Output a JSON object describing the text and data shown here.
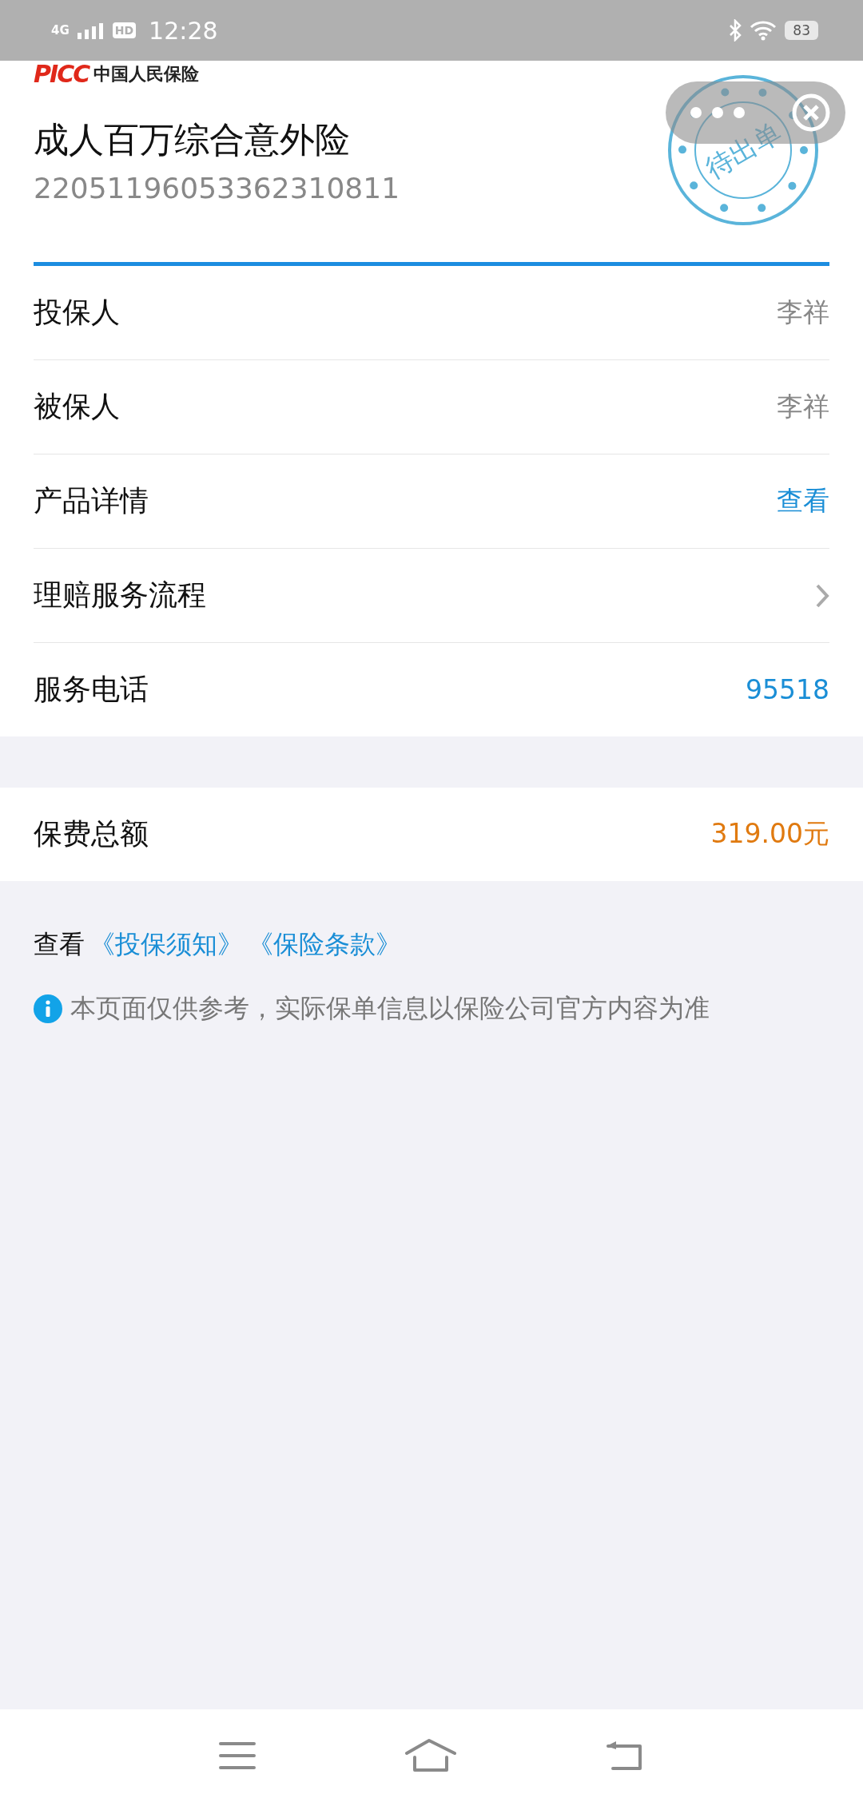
{
  "status_bar": {
    "network": "4G",
    "hd": "HD",
    "time": "12:28",
    "battery": "83"
  },
  "header": {
    "brand": "中国人民保险",
    "brand_mark": "PICC",
    "title": "成人百万综合意外险",
    "policy_no": "22051196053362310811",
    "stamp": "待出单"
  },
  "rows": [
    {
      "label": "投保人",
      "kind": "text",
      "value": "李祥"
    },
    {
      "label": "被保人",
      "kind": "text",
      "value": "李祥"
    },
    {
      "label": "产品详情",
      "kind": "link",
      "value": "查看"
    },
    {
      "label": "理赔服务流程",
      "kind": "chevron"
    },
    {
      "label": "服务电话",
      "kind": "link",
      "value": "95518"
    }
  ],
  "premium": {
    "label": "保费总额",
    "value": "319.00元"
  },
  "docs": {
    "prefix": "查看",
    "links": [
      "《投保须知》",
      "《保险条款》"
    ]
  },
  "notice": "本页面仅供参考，实际保单信息以保险公司官方内容为准"
}
